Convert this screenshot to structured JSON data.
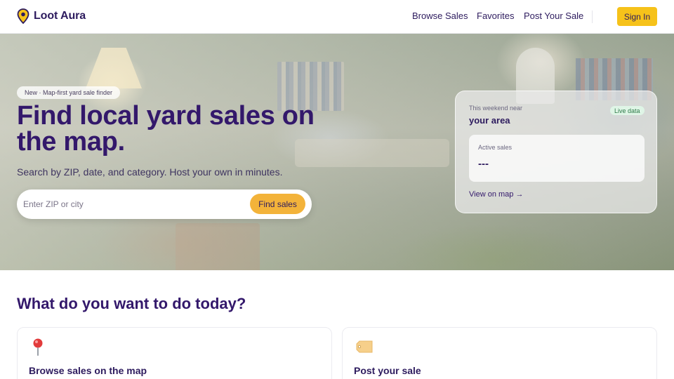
{
  "brand": {
    "name": "Loot Aura"
  },
  "nav": {
    "items": [
      {
        "label": "Browse Sales"
      },
      {
        "label": "Favorites"
      },
      {
        "label": "Post Your Sale"
      }
    ],
    "signin_label": "Sign In"
  },
  "hero": {
    "badge": "New · Map-first yard sale finder",
    "title": "Find local yard sales on the map.",
    "subtitle": "Search by ZIP, date, and category. Host your own in minutes.",
    "search": {
      "placeholder": "Enter ZIP or city",
      "value": "",
      "button_label": "Find sales"
    }
  },
  "area_card": {
    "eyebrow": "This weekend near",
    "title": "your area",
    "live_badge": "Live data",
    "active_label": "Active sales",
    "active_value": "---",
    "map_link": "View on map →"
  },
  "actions_section": {
    "title": "What do you want to do today?",
    "cards": [
      {
        "title": "Browse sales on the map",
        "icon": "map-pin-icon"
      },
      {
        "title": "Post your sale",
        "icon": "price-tag-icon"
      }
    ]
  },
  "colors": {
    "brand_purple": "#33186b",
    "accent_yellow": "#f6c21a",
    "button_orange": "#f3b33a",
    "live_green": "#2f7a4a"
  }
}
